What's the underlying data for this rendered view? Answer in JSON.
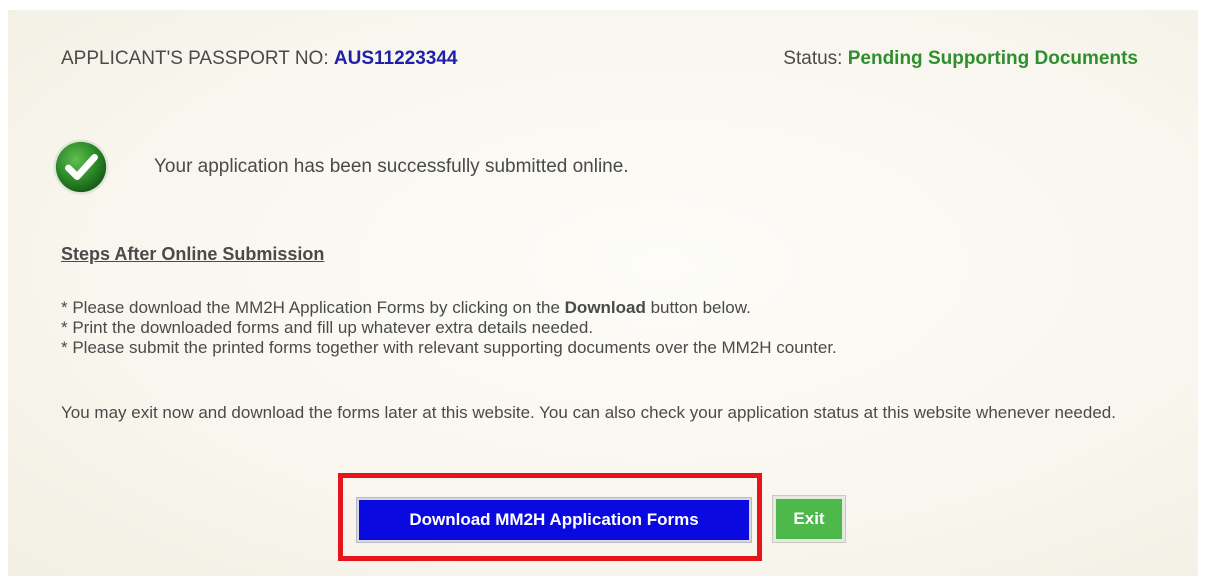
{
  "header": {
    "passport_label": "APPLICANT'S PASSPORT NO: ",
    "passport_value": "AUS11223344",
    "status_label": "Status: ",
    "status_value": "Pending Supporting Documents"
  },
  "success": {
    "icon": "check-icon",
    "message": "Your application has been successfully submitted online."
  },
  "steps": {
    "heading": "Steps After Online Submission",
    "items": [
      {
        "prefix": "* Please download the MM2H Application Forms by clicking on the ",
        "bold": "Download",
        "suffix": " button below."
      },
      {
        "text": "* Print the downloaded forms and fill up whatever extra details needed."
      },
      {
        "text": "* Please submit the printed forms together with relevant supporting documents over the MM2H counter."
      }
    ]
  },
  "note": "You may exit now and download the forms later at this website. You can also check your application status at this website whenever needed.",
  "actions": {
    "download_label": "Download MM2H Application Forms",
    "exit_label": "Exit"
  },
  "colors": {
    "passport_value": "#1f1fa8",
    "status_value": "#2f8f2f",
    "download_button": "#0a0ae0",
    "exit_button": "#4cb94a",
    "highlight_border": "#e8141c"
  }
}
